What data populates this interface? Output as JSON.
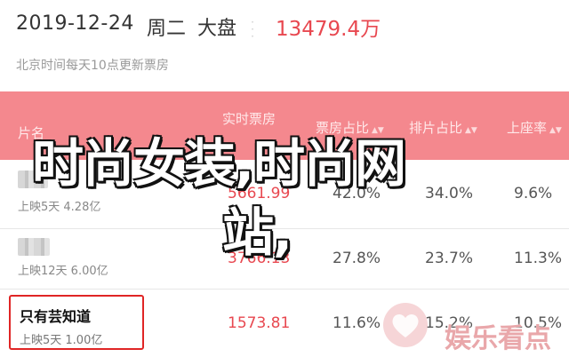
{
  "header": {
    "date": "2019-12-24",
    "weekday": "周二",
    "label": "大盘",
    "total": "13479.4万",
    "subtitle": "北京时间每天10点更新票房"
  },
  "columns": {
    "name": "片名",
    "box_line1": "实时票房",
    "box_line2": "",
    "pct": "票房占比",
    "sched": "排片占比",
    "seat": "上座率"
  },
  "rows": [
    {
      "title": "",
      "sub": "上映5天 4.28亿",
      "box": "5661.99",
      "pct": "42.0%",
      "sched": "34.0%",
      "seat": "9.6%"
    },
    {
      "title": "",
      "sub": "上映12天 6.00亿",
      "box": "3766.13",
      "pct": "27.8%",
      "sched": "23.7%",
      "seat": "11.3%"
    },
    {
      "title": "只有芸知道",
      "sub": "上映5天 1.00亿",
      "box": "1573.81",
      "pct": "11.6%",
      "sched": "15.2%",
      "seat": "10.5%"
    }
  ],
  "overlay": {
    "line1": "时尚女装,时尚网",
    "line2": "站,"
  },
  "watermark": {
    "text": "娱乐看点"
  },
  "colors": {
    "accent": "#e84850",
    "header_bg": "#f4888e",
    "highlight_border": "#e02525"
  }
}
